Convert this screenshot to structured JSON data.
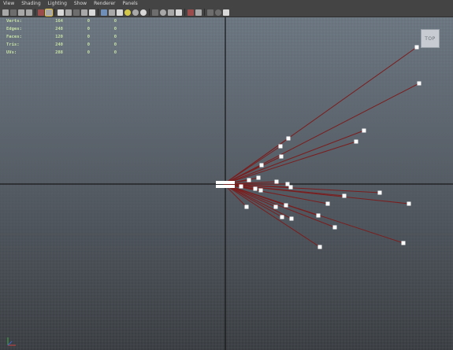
{
  "menu": [
    "View",
    "Shading",
    "Lighting",
    "Show",
    "Renderer",
    "Panels"
  ],
  "toolbar": {
    "icons": [
      "select-camera-icon",
      "camera-attributes-icon",
      "bookmark-icon",
      "image-plane-icon",
      "grid-icon",
      "film-gate-icon",
      "resolution-gate-icon",
      "gate-mask-icon",
      "field-chart-icon",
      "safe-action-icon",
      "safe-title-icon",
      "wireframe-icon",
      "smooth-shade-icon",
      "use-default-material-icon",
      "wireframe-on-shaded-icon",
      "textured-icon",
      "use-all-lights-icon",
      "shadows-icon",
      "screen-space-ambient-occlusion-icon",
      "motion-blur-icon",
      "multisample-antialiasing-icon",
      "depth-of-field-icon",
      "isolate-select-icon",
      "xray-icon",
      "xray-active-components-icon",
      "xray-joints-icon"
    ]
  },
  "hud": {
    "rows": [
      {
        "label": "Verts:",
        "total": "164",
        "selected": "0",
        "components": "0"
      },
      {
        "label": "Edges:",
        "total": "248",
        "selected": "0",
        "components": "0"
      },
      {
        "label": "Faces:",
        "total": "120",
        "selected": "0",
        "components": "0"
      },
      {
        "label": "Tris:",
        "total": "240",
        "selected": "0",
        "components": "0"
      },
      {
        "label": "UVs:",
        "total": "288",
        "selected": "0",
        "components": "0"
      }
    ]
  },
  "view_cube": {
    "label": "TOP"
  },
  "scene": {
    "origin": [
      0,
      0
    ],
    "grid_color": "#5f656b",
    "axis_color": "#1a1a1a",
    "line_color": "#7a1e1e",
    "joint_color": "#ffffff",
    "ends": [
      [
        245,
        174
      ],
      [
        248,
        128
      ],
      [
        178,
        68
      ],
      [
        168,
        54
      ],
      [
        82,
        58
      ],
      [
        72,
        48
      ],
      [
        73,
        35
      ],
      [
        48,
        24
      ],
      [
        44,
        8
      ],
      [
        32,
        5
      ],
      [
        67,
        3
      ],
      [
        81,
        0
      ],
      [
        85,
        -4
      ],
      [
        22,
        -3
      ],
      [
        40,
        -6
      ],
      [
        47,
        -8
      ],
      [
        198,
        -11
      ],
      [
        153,
        -15
      ],
      [
        235,
        -25
      ],
      [
        132,
        -25
      ],
      [
        120,
        -40
      ],
      [
        86,
        -44
      ],
      [
        74,
        -42
      ],
      [
        66,
        -29
      ],
      [
        79,
        -27
      ],
      [
        29,
        -29
      ],
      [
        141,
        -55
      ],
      [
        228,
        -75
      ],
      [
        122,
        -80
      ]
    ]
  }
}
